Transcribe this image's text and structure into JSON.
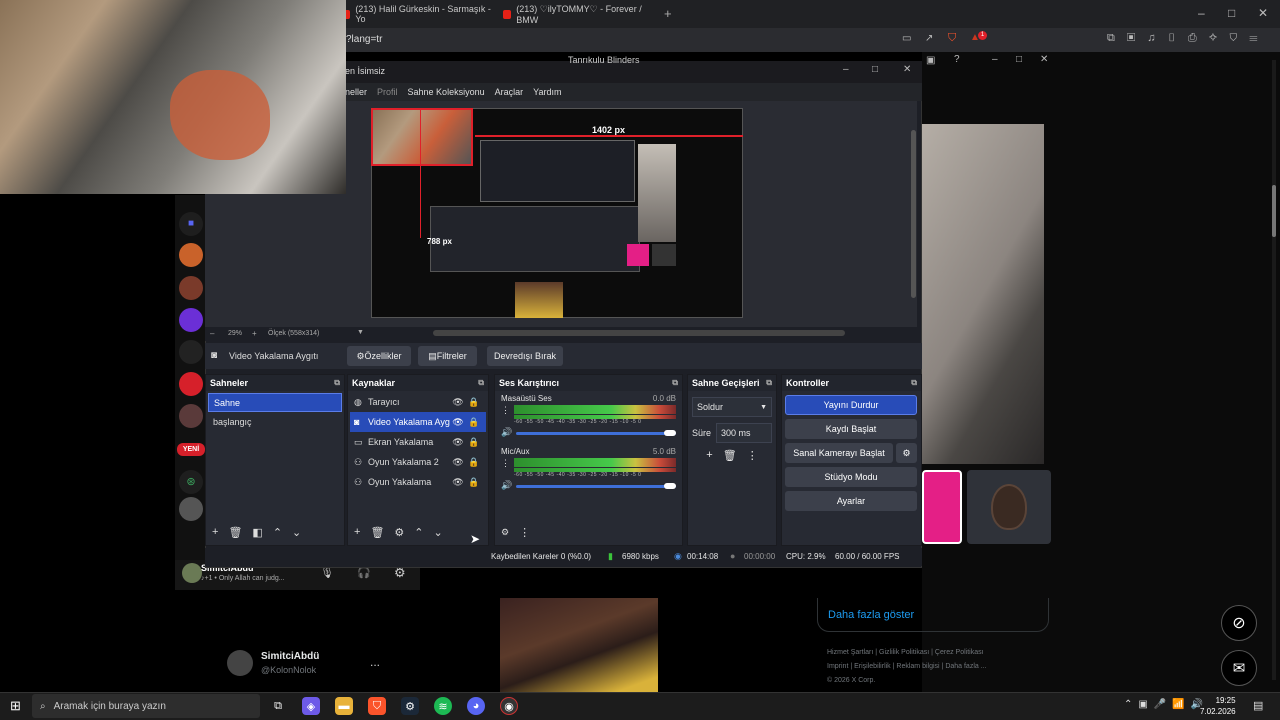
{
  "browser": {
    "tabs": [
      {
        "title": "(213) Halil Gürkeskin - Sarmaşık - Yo"
      },
      {
        "title": "(213) ♡ilyTOMMY♡ - Forever / BMW"
      }
    ],
    "new_tab": "+",
    "url_fragment": "?lang=tr",
    "brave_badge": "1",
    "window_controls": [
      "–",
      "□",
      "✕"
    ]
  },
  "obs": {
    "title_fragment": "en İsimsiz",
    "behind_title": "Tanrıkulu Blinders",
    "menu": [
      "neller",
      "Profil",
      "Sahne Koleksiyonu",
      "Araçlar",
      "Yardım"
    ],
    "preview": {
      "width_label": "1402 px",
      "height_label": "788 px"
    },
    "zoom": {
      "minus": "–",
      "value": "29%",
      "plus": "+",
      "scale": "Ölçek (558x314)"
    },
    "source_bar": {
      "name": "Video Yakalama Aygıtı",
      "buttons": [
        "Özellikler",
        "Filtreler",
        "Devredışı Bırak"
      ]
    },
    "scenes": {
      "title": "Sahneler",
      "items": [
        "Sahne",
        "başlangıç"
      ],
      "selected": "Sahne"
    },
    "sources": {
      "title": "Kaynaklar",
      "items": [
        {
          "name": "Tarayıcı",
          "icon": "globe-icon"
        },
        {
          "name": "Video Yakalama Aygıtı",
          "icon": "camera-icon"
        },
        {
          "name": "Ekran Yakalama",
          "icon": "monitor-icon"
        },
        {
          "name": "Oyun Yakalama 2",
          "icon": "gamepad-icon"
        },
        {
          "name": "Oyun Yakalama",
          "icon": "gamepad-icon"
        }
      ],
      "selected": "Video Yakalama Aygıtı"
    },
    "mixer": {
      "title": "Ses Karıştırıcı",
      "channels": [
        {
          "name": "Masaüstü Ses",
          "db": "0.0 dB",
          "volume": 1.0
        },
        {
          "name": "Mic/Aux",
          "db": "5.0 dB",
          "volume": 1.0
        }
      ],
      "ticks": "-60 -55 -50 -45 -40 -35 -30 -25 -20 -15 -10 -5 0"
    },
    "transitions": {
      "title": "Sahne Geçişleri",
      "type": "Soldur",
      "duration_label": "Süre",
      "duration": "300 ms"
    },
    "controls": {
      "title": "Kontroller",
      "buttons": [
        "Yayını Durdur",
        "Kaydı Başlat",
        "Sanal Kamerayı Başlat",
        "Stüdyo Modu",
        "Ayarlar"
      ]
    },
    "status": {
      "dropped": "Kaybedilen Kareler 0 (%0.0)",
      "bitrate": "6980 kbps",
      "stream_time": "00:14:08",
      "rec_time": "00:00:00",
      "cpu": "CPU: 2.9%",
      "fps": "60.00 / 60.00 FPS"
    }
  },
  "social": {
    "more_link": "Daha fazla göster",
    "footer": [
      "Hizmet Şartları",
      "Gizlilik Politikası",
      "Çerez Politikası",
      "Imprint",
      "Erişilebilirlik",
      "Reklam bilgisi",
      "Daha fazla ...",
      "© 2026 X Corp."
    ],
    "post_name": "SimitciAbdü",
    "post_handle": "@KolonNolok",
    "post_more": "...",
    "user_name": "SimitciAbdü",
    "user_status": "♪+1 • Only Allah can judg...",
    "new_badge": "YENİ"
  },
  "taskbar": {
    "search_placeholder": "Aramak için buraya yazın",
    "time": "19:25",
    "date": "7.02.2026"
  }
}
